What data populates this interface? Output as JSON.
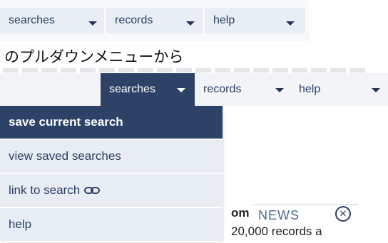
{
  "top_menu": {
    "items": [
      {
        "label": "searches",
        "icon": "caret-down-icon"
      },
      {
        "label": "records",
        "icon": "caret-down-icon"
      },
      {
        "label": "help",
        "icon": "caret-down-icon"
      }
    ]
  },
  "caption": "のプルダウンメニューから",
  "menubar": {
    "items": [
      {
        "label": "searches",
        "active": true
      },
      {
        "label": "records"
      },
      {
        "label": "help"
      }
    ]
  },
  "dropdown": {
    "items": [
      {
        "label": "save current search",
        "selected": true
      },
      {
        "label": "view saved searches"
      },
      {
        "label": "link to search",
        "icon": "link-icon"
      },
      {
        "label": "help"
      }
    ]
  },
  "news": {
    "title": "NEWS",
    "partial_line1": "om V",
    "partial_line2": "20,000 records a",
    "close_icon": "close-icon"
  },
  "colors": {
    "menu_bg": "#e9eef5",
    "active_bg": "#2e4268",
    "text": "#2c3f63"
  }
}
